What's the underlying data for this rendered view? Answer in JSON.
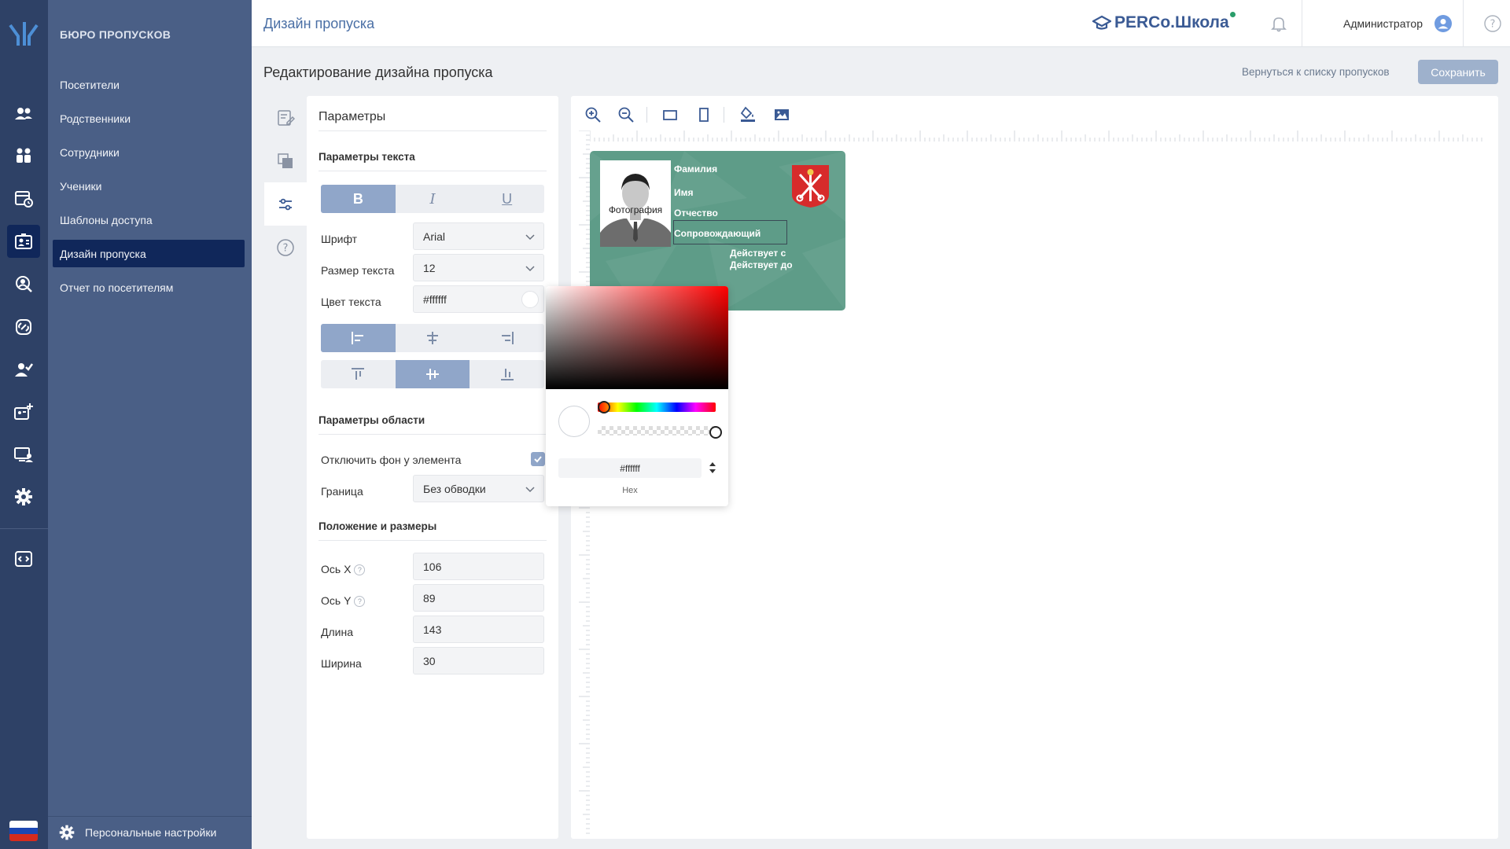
{
  "sidebar": {
    "brand": "БЮРО ПРОПУСКОВ",
    "items": [
      {
        "label": "Посетители"
      },
      {
        "label": "Родственники"
      },
      {
        "label": "Сотрудники"
      },
      {
        "label": "Ученики"
      },
      {
        "label": "Шаблоны доступа"
      },
      {
        "label": "Дизайн пропуска"
      },
      {
        "label": "Отчет по посетителям"
      }
    ],
    "active_item": "Дизайн пропуска",
    "personal_settings": "Персональные настройки",
    "rail_icons": [
      "visitors-icon",
      "relatives-icon",
      "calendar-icon",
      "pass-design-icon",
      "search-user-icon",
      "link-icon",
      "user-check-icon",
      "badge-add-icon",
      "user-screen-icon",
      "gear-icon",
      "code-icon"
    ]
  },
  "header": {
    "page_title": "Дизайн пропуска",
    "brand_logo_text": "PERCo.Школа",
    "user_name": "Администратор"
  },
  "subheader": {
    "title": "Редактирование дизайна пропуска",
    "back_link": "Вернуться к списку пропусков",
    "save_label": "Сохранить"
  },
  "params": {
    "title": "Параметры",
    "text_section": "Параметры текста",
    "style_buttons": {
      "bold": "B",
      "italic": "I",
      "underline": "U",
      "active": "bold"
    },
    "font_label": "Шрифт",
    "font_value": "Arial",
    "size_label": "Размер текста",
    "size_value": "12",
    "color_label": "Цвет текста",
    "color_value": "#ffffff",
    "h_align_active": "left",
    "v_align_active": "middle",
    "area_section": "Параметры области",
    "disable_bg_label": "Отключить фон у элемента",
    "disable_bg_checked": true,
    "border_label": "Граница",
    "border_value": "Без обводки",
    "position_section": "Положение и размеры",
    "axis_x_label": "Ось X",
    "axis_x_value": "106",
    "axis_y_label": "Ось Y",
    "axis_y_value": "89",
    "length_label": "Длина",
    "length_value": "143",
    "width_label": "Ширина",
    "width_value": "30"
  },
  "card": {
    "background": "#5e9c88",
    "photo_label": "Фотография",
    "fields": {
      "surname": "Фамилия",
      "name": "Имя",
      "patronymic": "Отчество",
      "escort": "Сопровождающий",
      "valid_from": "Действует с",
      "valid_to": "Действует до"
    }
  },
  "color_picker": {
    "hex_value": "#ffffff",
    "hex_label": "Hex"
  }
}
